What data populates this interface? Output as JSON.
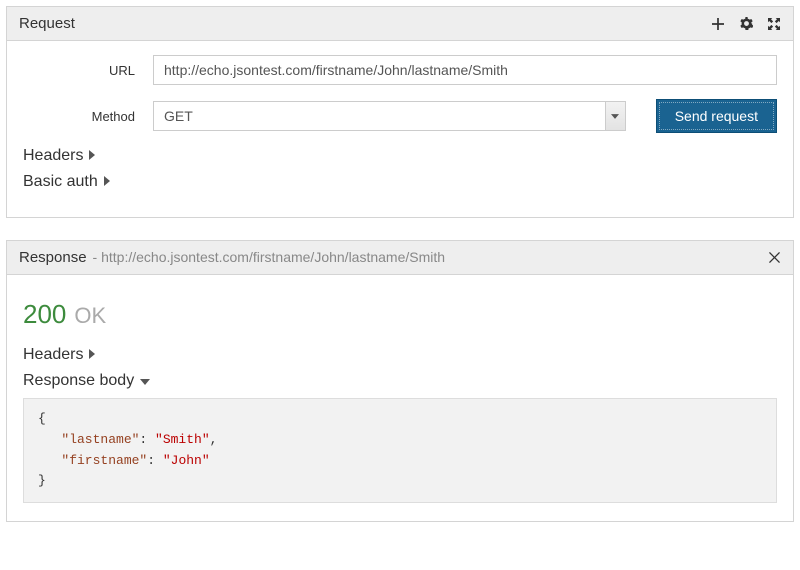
{
  "request": {
    "title": "Request",
    "url_label": "URL",
    "url_value": "http://echo.jsontest.com/firstname/John/lastname/Smith",
    "method_label": "Method",
    "method_value": "GET",
    "send_label": "Send request",
    "headers_label": "Headers",
    "basic_auth_label": "Basic auth"
  },
  "response": {
    "title": "Response",
    "url": "http://echo.jsontest.com/firstname/John/lastname/Smith",
    "status_code": "200",
    "status_text": "OK",
    "headers_label": "Headers",
    "body_label": "Response body",
    "body": {
      "key1": "\"lastname\"",
      "val1": "\"Smith\"",
      "key2": "\"firstname\"",
      "val2": "\"John\""
    }
  },
  "glyphs": {
    "brace_open": "{",
    "brace_close": "}",
    "colon": ": ",
    "comma": ",",
    "dash": " - "
  }
}
